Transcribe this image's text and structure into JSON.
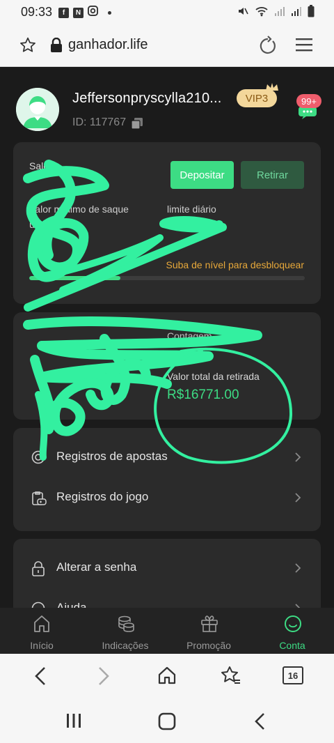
{
  "status_bar": {
    "time": "09:33",
    "note_icon": "N"
  },
  "browser": {
    "url": "ganhador.life",
    "tab_count": "16"
  },
  "profile": {
    "username": "Jeffersonpryscylla210...",
    "vip": "VIP3",
    "id": "ID: 117767",
    "messages_badge": "99+"
  },
  "balance_card": {
    "saldo_label": "Saldo",
    "deposit_label": "Depositar",
    "withdraw_label": "Retirar",
    "min_withdraw_label": "Valor mínimo de saque",
    "min_withdraw_label2": "único",
    "daily_limit_label": "limite diário",
    "unlock_text": "Suba de nível para desbloquear",
    "progress_fraction": 0.33
  },
  "totals_card": {
    "label_top": "Contagem",
    "total_withdraw_label": "Valor total da retirada",
    "total_withdraw_value": "R$16771.00"
  },
  "records_menu": [
    {
      "label": "Registros de apostas",
      "icon": "target-icon"
    },
    {
      "label": "Registros do jogo",
      "icon": "game-record-icon"
    }
  ],
  "settings_menu": [
    {
      "label": "Alterar a senha",
      "icon": "lock-icon"
    },
    {
      "label": "Ajuda",
      "icon": "help-icon"
    }
  ],
  "tabs": [
    {
      "label": "Início",
      "icon": "home-icon"
    },
    {
      "label": "Indicações",
      "icon": "coins-icon"
    },
    {
      "label": "Promoção",
      "icon": "gift-icon"
    },
    {
      "label": "Conta",
      "icon": "smile-icon",
      "active": true
    }
  ],
  "colors": {
    "accent": "#3ddc84",
    "warning": "#e7a83a",
    "background": "#1b1b1b",
    "card": "#2b2b2b",
    "scribble": "#33f0a0"
  }
}
